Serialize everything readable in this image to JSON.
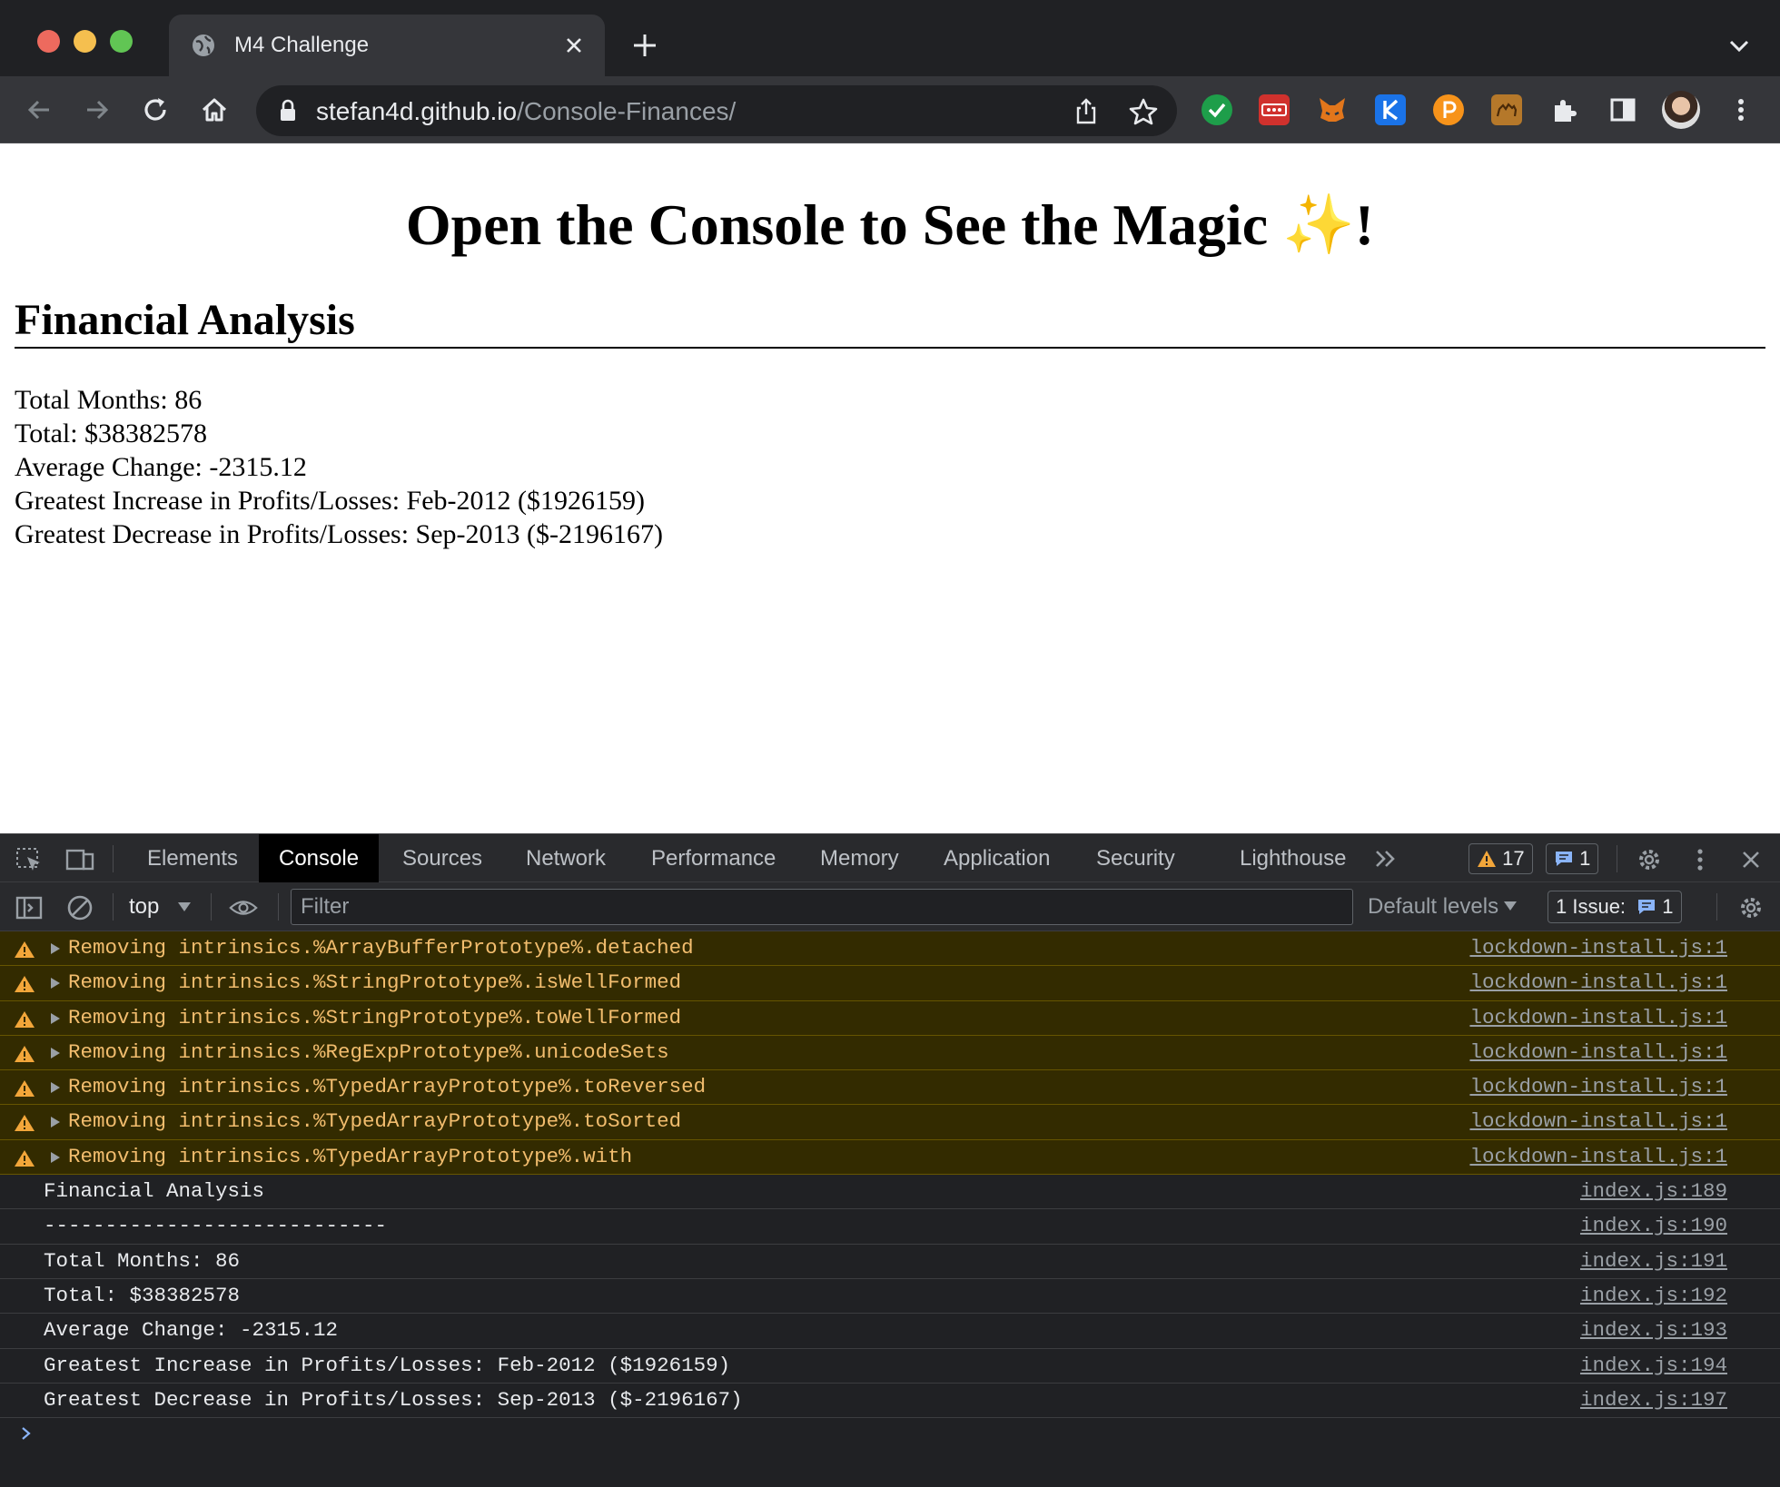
{
  "browser": {
    "tab_title": "M4 Challenge",
    "url_host": "stefan4d.github.io",
    "url_path": "/Console-Finances/"
  },
  "page": {
    "heading": "Open the Console to See the Magic",
    "heading_sparkle": "✨",
    "heading_end": "!",
    "section_heading": "Financial Analysis",
    "lines": [
      "Total Months: 86",
      "Total: $38382578",
      "Average Change: -2315.12",
      "Greatest Increase in Profits/Losses: Feb-2012 ($1926159)",
      "Greatest Decrease in Profits/Losses: Sep-2013 ($-2196167)"
    ]
  },
  "devtools": {
    "tabs": [
      "Elements",
      "Console",
      "Sources",
      "Network",
      "Performance",
      "Memory",
      "Application",
      "Security",
      "Lighthouse"
    ],
    "active_tab": "Console",
    "warnings_count": "17",
    "messages_count": "1",
    "context": "top",
    "filter_placeholder": "Filter",
    "levels_label": "Default levels",
    "issues_label": "1 Issue:",
    "issues_count": "1",
    "console_rows": [
      {
        "type": "warning",
        "message": "Removing intrinsics.%ArrayBufferPrototype%.detached",
        "source": "lockdown-install.js:1"
      },
      {
        "type": "warning",
        "message": "Removing intrinsics.%StringPrototype%.isWellFormed",
        "source": "lockdown-install.js:1"
      },
      {
        "type": "warning",
        "message": "Removing intrinsics.%StringPrototype%.toWellFormed",
        "source": "lockdown-install.js:1"
      },
      {
        "type": "warning",
        "message": "Removing intrinsics.%RegExpPrototype%.unicodeSets",
        "source": "lockdown-install.js:1"
      },
      {
        "type": "warning",
        "message": "Removing intrinsics.%TypedArrayPrototype%.toReversed",
        "source": "lockdown-install.js:1"
      },
      {
        "type": "warning",
        "message": "Removing intrinsics.%TypedArrayPrototype%.toSorted",
        "source": "lockdown-install.js:1"
      },
      {
        "type": "warning",
        "message": "Removing intrinsics.%TypedArrayPrototype%.with",
        "source": "lockdown-install.js:1"
      },
      {
        "type": "log",
        "message": "Financial Analysis",
        "source": "index.js:189"
      },
      {
        "type": "log",
        "message": "----------------------------",
        "source": "index.js:190"
      },
      {
        "type": "log",
        "message": "Total Months: 86",
        "source": "index.js:191"
      },
      {
        "type": "log",
        "message": "Total: $38382578",
        "source": "index.js:192"
      },
      {
        "type": "log",
        "message": "Average Change: -2315.12",
        "source": "index.js:193"
      },
      {
        "type": "log",
        "message": "Greatest Increase in Profits/Losses: Feb-2012 ($1926159)",
        "source": "index.js:194"
      },
      {
        "type": "log",
        "message": "Greatest Decrease in Profits/Losses: Sep-2013 ($-2196167)",
        "source": "index.js:197"
      }
    ]
  },
  "colors": {
    "warning_bg": "#332b00",
    "warning_text": "#f2bd6e",
    "accent_blue": "#8ab4f8"
  }
}
